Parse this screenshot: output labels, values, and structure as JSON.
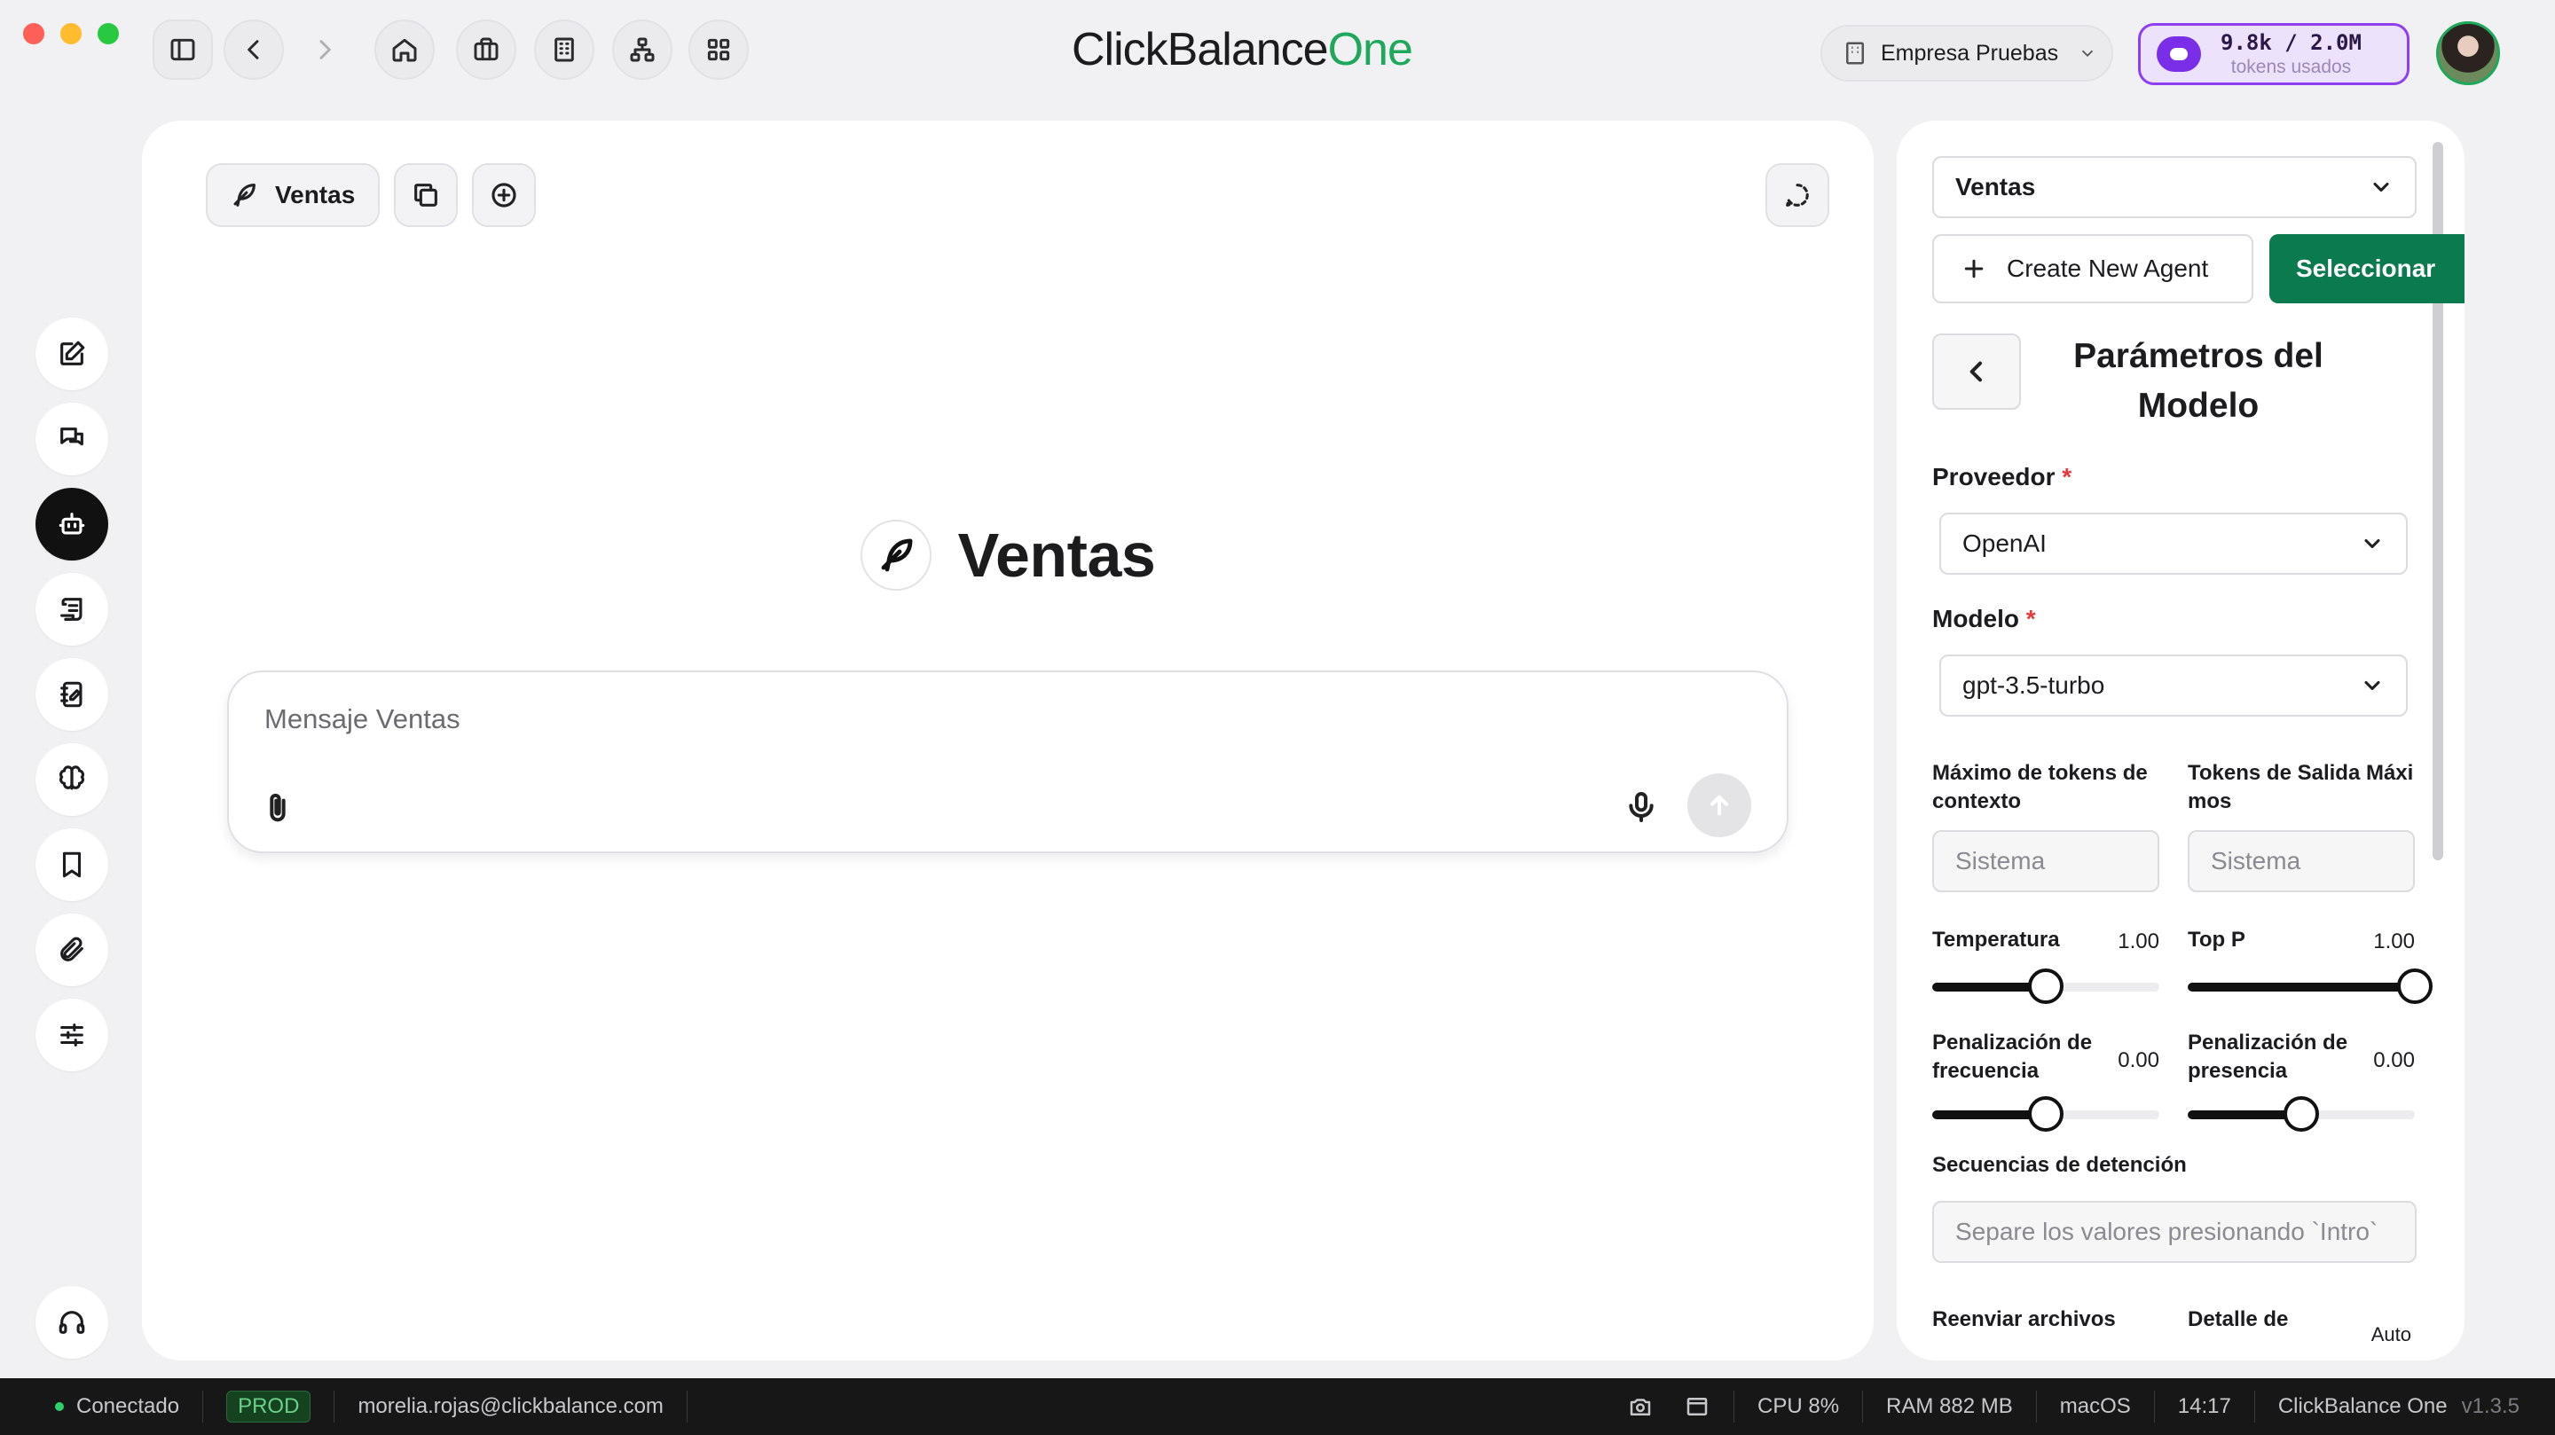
{
  "titlebar": {
    "brand_main": "ClickBalance",
    "brand_accent": "One",
    "company": "Empresa Pruebas",
    "tokens_count": "9.8k / 2.0M",
    "tokens_label": "tokens usados"
  },
  "rail": {
    "items": [
      {
        "icon": "edit-icon"
      },
      {
        "icon": "chats-icon"
      },
      {
        "icon": "bot-icon",
        "active": true
      },
      {
        "icon": "scroll-icon"
      },
      {
        "icon": "notebook-icon"
      },
      {
        "icon": "brain-icon"
      },
      {
        "icon": "bookmark-icon"
      },
      {
        "icon": "paperclip-icon"
      },
      {
        "icon": "sliders-icon"
      },
      {
        "icon": "headset-icon"
      }
    ]
  },
  "main": {
    "agent_chip_label": "Ventas",
    "hero_title": "Ventas",
    "composer_placeholder": "Mensaje Ventas"
  },
  "side": {
    "agent_select": "Ventas",
    "create_label": "Create New Agent",
    "select_label": "Seleccionar",
    "title": "Parámetros del Modelo",
    "provider_label": "Proveedor",
    "provider_value": "OpenAI",
    "model_label": "Modelo",
    "model_value": "gpt-3.5-turbo",
    "required_mark": "*",
    "max_context_label": "Máximo de tokens de contexto",
    "max_context_placeholder": "Sistema",
    "max_output_label": "Tokens de Salida Máxi mos",
    "max_output_placeholder": "Sistema",
    "temperature_label": "Temperatura",
    "temperature_value": "1.00",
    "temperature_level": 0.5,
    "top_p_label": "Top P",
    "top_p_value": "1.00",
    "top_p_level": 1.0,
    "freq_label": "Penalización de frecuencia",
    "freq_value": "0.00",
    "freq_level": 0.5,
    "presence_label": "Penalización de presencia",
    "presence_value": "0.00",
    "presence_level": 0.5,
    "stop_label": "Secuencias de detención",
    "stop_placeholder": "Separe los valores presionando `Intro`",
    "resend_label": "Reenviar archivos",
    "detail_label": "Detalle de",
    "detail_value": "Auto"
  },
  "statusbar": {
    "connection": "Conectado",
    "env": "PROD",
    "email": "morelia.rojas@clickbalance.com",
    "cpu": "CPU 8%",
    "ram": "RAM 882 MB",
    "os": "macOS",
    "time": "14:17",
    "app": "ClickBalance One",
    "version": "v1.3.5"
  }
}
